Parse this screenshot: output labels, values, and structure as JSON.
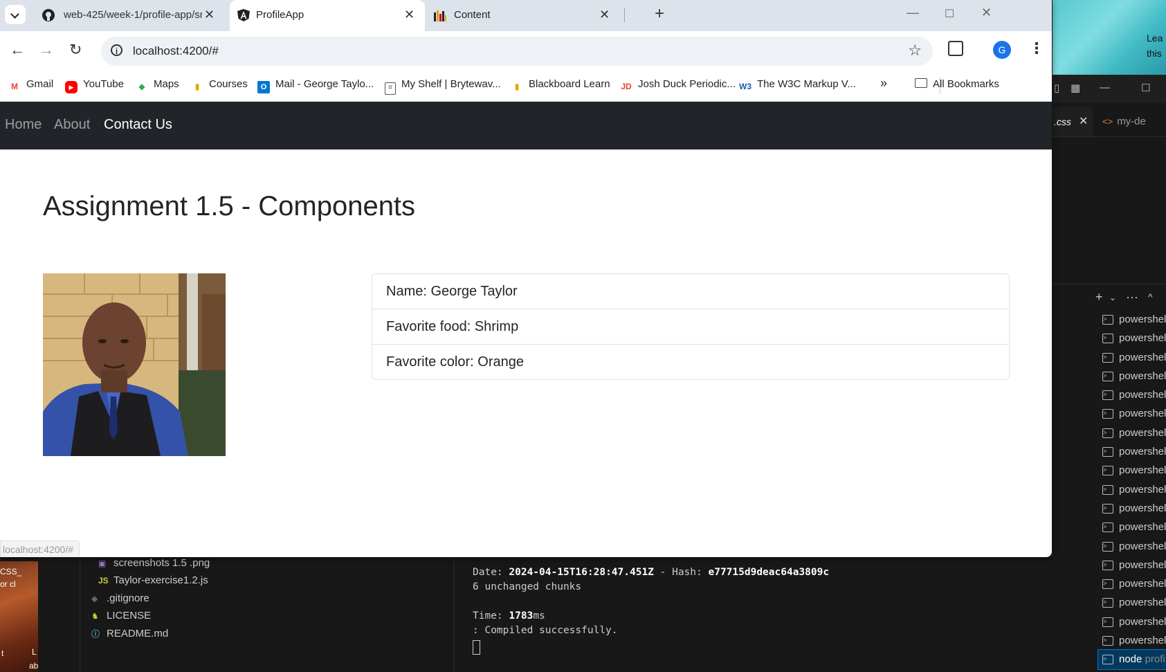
{
  "desktop": {
    "snippet_lines": [
      "Lea",
      "this"
    ]
  },
  "vscode": {
    "tab_css": ".css",
    "tab_other": "my-de",
    "terminals": [
      "powershel",
      "powershel",
      "powershel",
      "powershel",
      "powershel",
      "powershel",
      "powershel",
      "powershel",
      "powershel",
      "powershel",
      "powershel",
      "powershel",
      "powershel",
      "powershel",
      "powershel",
      "powershel",
      "powershel",
      "powershel"
    ],
    "terminal_active": "node",
    "terminal_active_suffix": "profi",
    "thumb_text": [
      "CSS_",
      "or cl",
      "t",
      "L",
      "ab"
    ],
    "explorer": [
      "screenshots 1.5 .png",
      "Taylor-exercise1.2.js",
      ".gitignore",
      "LICENSE",
      "README.md"
    ],
    "terminal_output": {
      "date_label": "Date: ",
      "date_value": "2024-04-15T16:28:47.451Z",
      "hash_label": " - Hash: ",
      "hash_value": "e77715d9deac64a3809c",
      "chunks": "6 unchanged chunks",
      "time_label": "Time: ",
      "time_value": "1783",
      "time_unit": "ms",
      "compiled": ": Compiled successfully."
    }
  },
  "browser": {
    "tabs": [
      {
        "title": "web-425/week-1/profile-app/sr"
      },
      {
        "title": "ProfileApp"
      },
      {
        "title": "Content"
      }
    ],
    "url": "localhost:4200/#",
    "avatar_letter": "G",
    "bookmarks": [
      "Gmail",
      "YouTube",
      "Maps",
      "Courses",
      "Mail - George Taylo...",
      "My Shelf | Brytewav...",
      "Blackboard Learn",
      "Josh Duck Periodic...",
      "The W3C Markup V..."
    ],
    "all_bookmarks": "All Bookmarks",
    "status_url": "localhost:4200/#"
  },
  "page": {
    "nav": [
      "Home",
      "About",
      "Contact Us"
    ],
    "title": "Assignment 1.5 - Components",
    "profile": [
      "Name: George Taylor",
      "Favorite food: Shrimp",
      "Favorite color: Orange"
    ]
  },
  "colors": {
    "navbar": "#212529",
    "accent_vscode": "#0078d4"
  }
}
